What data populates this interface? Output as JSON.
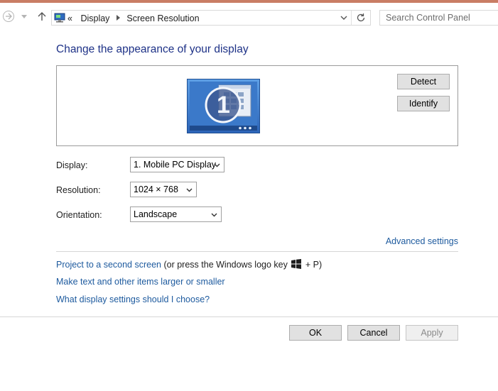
{
  "address_bar": {
    "overflow_marker": "«",
    "crumbs": [
      "Display",
      "Screen Resolution"
    ]
  },
  "search": {
    "placeholder": "Search Control Panel"
  },
  "page_title": "Change the appearance of your display",
  "monitor": {
    "number": "1"
  },
  "buttons": {
    "detect": "Detect",
    "identify": "Identify",
    "ok": "OK",
    "cancel": "Cancel",
    "apply": "Apply"
  },
  "fields": {
    "display": {
      "label": "Display:",
      "value": "1. Mobile PC Display"
    },
    "resolution": {
      "label": "Resolution:",
      "value": "1024 × 768"
    },
    "orientation": {
      "label": "Orientation:",
      "value": "Landscape"
    }
  },
  "links": {
    "advanced": "Advanced settings",
    "project": "Project to a second screen",
    "project_hint_pre": "(or press the Windows logo key",
    "project_hint_post": "+ P)",
    "text_size": "Make text and other items larger or smaller",
    "which_settings": "What display settings should I choose?"
  },
  "colors": {
    "title": "#1e3287",
    "link": "#1d5a9e",
    "monitor_blue": "#3a78c8"
  },
  "icons": [
    "back-arrow-icon",
    "forward-arrow-icon",
    "recent-dropdown-icon",
    "up-arrow-icon",
    "control-panel-icon",
    "chevron-right-icon",
    "chevron-down-icon",
    "refresh-icon",
    "windows-logo-icon"
  ]
}
